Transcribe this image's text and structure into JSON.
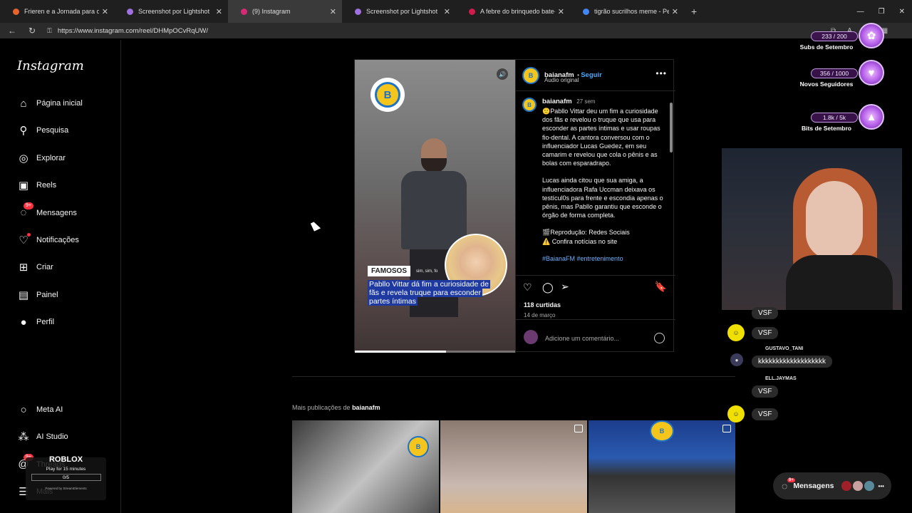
{
  "browser": {
    "tabs": [
      {
        "title": "Frieren e a Jornada para o Além",
        "color": "#e8622c",
        "active": false
      },
      {
        "title": "Screenshot por Lightshot",
        "color": "#a070e0",
        "active": false
      },
      {
        "title": "(9) Instagram",
        "color": "#d62976",
        "active": true
      },
      {
        "title": "Screenshot por Lightshot",
        "color": "#a070e0",
        "active": false
      },
      {
        "title": "A febre do brinquedo bate-bate",
        "color": "#d11b4a",
        "active": false
      },
      {
        "title": "tigrão sucrilhos meme - Pesquisa",
        "color": "#4285f4",
        "active": false
      }
    ],
    "url": "https://www.instagram.com/reel/DHMpOCvRqUW/"
  },
  "sidebar": {
    "logo": "Instagram",
    "items": [
      {
        "label": "Página inicial",
        "icon": "home-icon",
        "glyph": "⌂"
      },
      {
        "label": "Pesquisa",
        "icon": "search-icon",
        "glyph": "⚲"
      },
      {
        "label": "Explorar",
        "icon": "compass-icon",
        "glyph": "◎"
      },
      {
        "label": "Reels",
        "icon": "reels-icon",
        "glyph": "▣"
      },
      {
        "label": "Mensagens",
        "icon": "messenger-icon",
        "glyph": "◌",
        "badge": "9+"
      },
      {
        "label": "Notificações",
        "icon": "heart-icon",
        "glyph": "♡"
      },
      {
        "label": "Criar",
        "icon": "plus-square-icon",
        "glyph": "⊞"
      },
      {
        "label": "Painel",
        "icon": "dashboard-icon",
        "glyph": "▤"
      },
      {
        "label": "Perfil",
        "icon": "avatar-icon",
        "glyph": "●"
      }
    ],
    "bottom": [
      {
        "label": "Meta AI",
        "icon": "meta-ai-icon",
        "glyph": "○"
      },
      {
        "label": "AI Studio",
        "icon": "ai-studio-icon",
        "glyph": "⁂"
      },
      {
        "label": "Threads",
        "icon": "threads-icon",
        "glyph": "@",
        "badge": "9+"
      },
      {
        "label": "Mais",
        "icon": "menu-icon",
        "glyph": "☰"
      }
    ]
  },
  "post": {
    "video": {
      "tag": "FAMOSOS",
      "tag_small": "sim, sim, fo",
      "caption": "Pabllo Vittar dá fim a curiosidade de fãs e revela truque para esconder partes íntimas",
      "progress": 0.57,
      "logo_letter": "B"
    },
    "header": {
      "username": "baianafm",
      "follow": "Seguir",
      "audio": "Áudio original"
    },
    "comment": {
      "username": "baianafm",
      "time": "27 sem",
      "p1": "🙂Pabllo Vittar deu um fim a curiosidade dos fãs e revelou o truque que usa para esconder as partes íntimas e usar roupas fio-dental. A cantora conversou com o influenciador Lucas Guedez, em seu camarim  e revelou que cola o pênis e as bolas com esparadrapo.",
      "p2": "Lucas ainda citou que sua amiga, a influenciadora Rafa Uccman deixava os testícul0s para frente e escondia apenas o pênis, mas Pabllo garantiu que esconde o órgão de forma completa.",
      "p3a": "🎬Reprodução: Redes Sociais",
      "p3b": "⚠️ Confira notícias no site",
      "hashtags": "#BaianaFM #entretenimento"
    },
    "likes": "118 curtidas",
    "date": "14 de março",
    "comment_placeholder": "Adicione um comentário..."
  },
  "more": {
    "prefix": "Mais publicações de",
    "username": "baianafm"
  },
  "stream": {
    "goals": [
      {
        "value": "233 / 200",
        "label": "Subs de Setembro",
        "glyph": "✿"
      },
      {
        "value": "356 / 1000",
        "label": "Novos Seguidores",
        "glyph": "♥"
      },
      {
        "value": "1.8k / 5k",
        "label": "Bits de Setembro",
        "glyph": "▲"
      }
    ],
    "chat": [
      {
        "text": "VSF"
      },
      {
        "text": "VSF"
      },
      {
        "name": "GUSTAVO_TANI",
        "text": "kkkkkkkkkkkkkkkkkkk"
      },
      {
        "name": "ELL.JAYMAS",
        "text": "VSF"
      },
      {
        "text": "VSF"
      }
    ],
    "roblox": {
      "title": "ROBLOX",
      "subtitle": "Play for 15 minutes",
      "progress": "0/5",
      "powered": "Powered by StreamElements"
    },
    "messages_button": {
      "label": "Mensagens",
      "badge": "9+"
    }
  }
}
